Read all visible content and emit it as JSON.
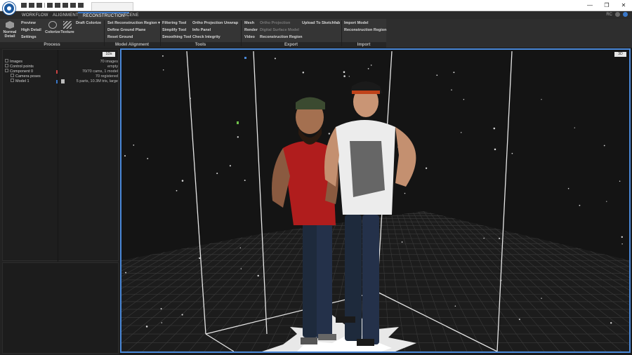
{
  "window": {
    "tab_title": "",
    "controls": [
      "—",
      "❐",
      "✕"
    ]
  },
  "ribbon_tabs": [
    {
      "label": "WORKFLOW",
      "active": false
    },
    {
      "label": "ALIGNMENT",
      "active": false
    },
    {
      "label": "RECONSTRUCTION",
      "active": true
    },
    {
      "label": "SCENE",
      "active": false
    }
  ],
  "ribbon_right": {
    "user": "RC"
  },
  "groups": {
    "process": {
      "label": "Process",
      "normal_detail": "Normal Detail",
      "preview": "Preview",
      "high_detail": "High Detail",
      "settings": "Settings",
      "colorize": "Colorize",
      "texture": "Texture",
      "draft_colorize": "Draft Colorize"
    },
    "model_alignment": {
      "label": "Model Alignment",
      "set_region": "Set Reconstruction Region",
      "define_ground": "Define Ground Plane",
      "reset_ground": "Reset Ground"
    },
    "tools": {
      "label": "Tools",
      "filtering": "Filtering Tool",
      "simplify": "Simplify Tool",
      "smoothing": "Smoothing Tool",
      "ortho": "Ortho Projection",
      "unwrap": "Unwrap",
      "info_panel": "Info Panel",
      "check_integrity": "Check Integrity"
    },
    "export": {
      "label": "Export",
      "mesh": "Mesh",
      "render": "Render",
      "video": "Video",
      "ortho": "Ortho Projection",
      "dsm": "Digital Surface Model",
      "recon_region": "Reconstruction Region",
      "sketchfab": "Upload To Sketchfab"
    },
    "import": {
      "label": "Import",
      "model": "Import Model",
      "region": "Reconstruction Region"
    }
  },
  "left_panel": {
    "badge": "1Ds",
    "tree": [
      {
        "label": "Images",
        "value": "70 images"
      },
      {
        "label": "Control points",
        "value": "empty"
      },
      {
        "label": "Component 0",
        "value": "70/70 cams, 1 model"
      },
      {
        "label": "Camera poses",
        "value": "70 registered"
      },
      {
        "label": "Model 1",
        "value": "5 parts, 10.3M tris, large"
      }
    ]
  },
  "viewport": {
    "badge": "3D"
  },
  "colors": {
    "accent": "#4a88d8",
    "ribbon_bg": "#353535",
    "panel_bg": "#1e1e1e",
    "viewport_bg": "#141414"
  }
}
